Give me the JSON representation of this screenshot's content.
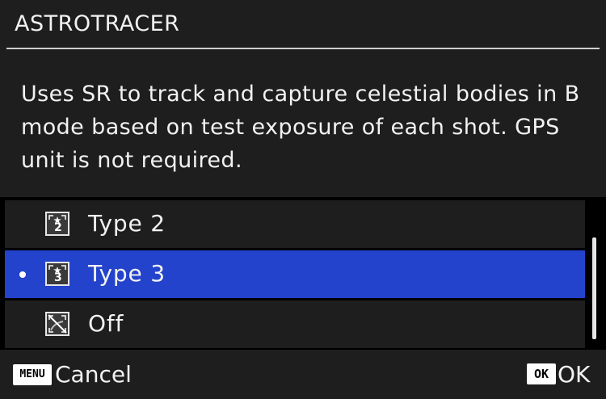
{
  "header": {
    "title": "ASTROTRACER"
  },
  "description": "Uses SR to track and capture celestial bodies in B mode based on test exposure of each shot. GPS unit is not required.",
  "options": [
    {
      "label": "Type 2",
      "icon": "astrotracer-type2-icon",
      "icon_number": "2",
      "selected": false
    },
    {
      "label": "Type 3",
      "icon": "astrotracer-type3-icon",
      "icon_number": "3",
      "selected": true
    },
    {
      "label": "Off",
      "icon": "astrotracer-off-icon",
      "selected": false
    }
  ],
  "footer": {
    "menu_key": "MENU",
    "cancel_label": "Cancel",
    "ok_key": "OK",
    "ok_label": "OK"
  },
  "colors": {
    "background": "#000000",
    "panel": "#1e1e1e",
    "selected": "#2343cc",
    "text": "#f2f2f2"
  }
}
